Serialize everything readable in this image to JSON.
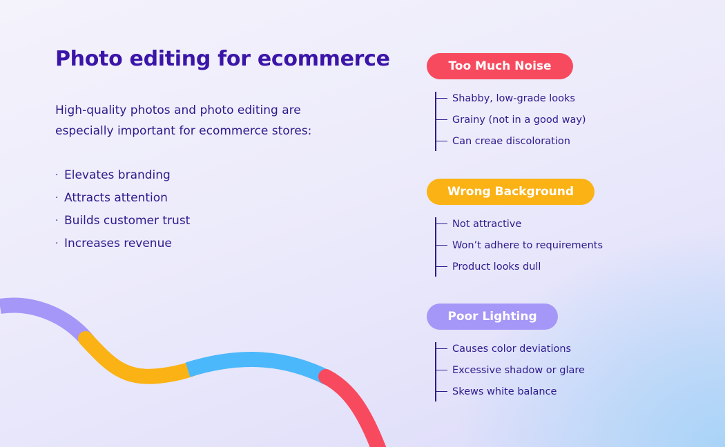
{
  "title": "Photo editing for ecommerce",
  "intro": "High-quality photos and photo editing are especially important for ecommerce stores:",
  "benefits": [
    "Elevates branding",
    "Attracts attention",
    "Builds customer trust",
    "Increases revenue"
  ],
  "bullet_glyph": "·",
  "problems": [
    {
      "label": "Too Much Noise",
      "color": "#f84a5e",
      "items": [
        "Shabby, low-grade looks",
        "Grainy (not in a good way)",
        "Can creae discoloration"
      ]
    },
    {
      "label": "Wrong Background",
      "color": "#fbb214",
      "items": [
        "Not attractive",
        "Won’t adhere to requirements",
        "Product looks dull"
      ]
    },
    {
      "label": "Poor Lighting",
      "color": "#a597f8",
      "items": [
        "Causes color deviations",
        "Excessive shadow or glare",
        "Skews white balance"
      ]
    }
  ],
  "wave_colors": {
    "purple": "#a597f8",
    "yellow": "#fbb214",
    "blue": "#4bb8fb",
    "red": "#f84a5e"
  }
}
